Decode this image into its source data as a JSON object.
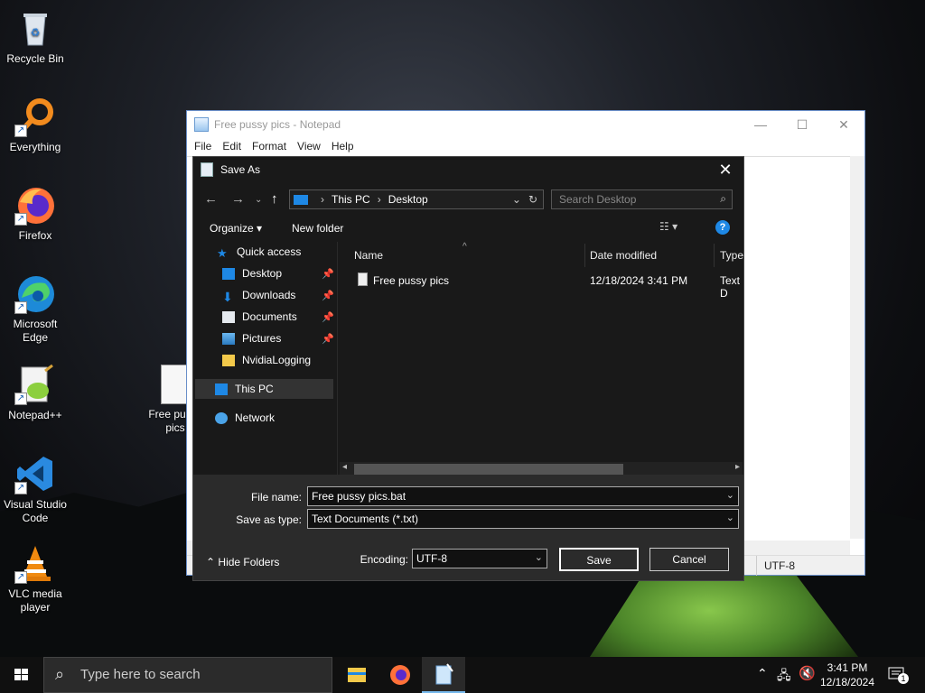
{
  "desktop": {
    "icons": [
      {
        "label": "Recycle Bin"
      },
      {
        "label": "Everything"
      },
      {
        "label": "Firefox"
      },
      {
        "label": "Microsoft Edge"
      },
      {
        "label": "Notepad++"
      },
      {
        "label": "Visual Studio Code"
      },
      {
        "label": "VLC media player"
      }
    ],
    "file_icon_label": "Free pussy pics"
  },
  "notepad": {
    "title": "Free pussy pics - Notepad",
    "menu": [
      "File",
      "Edit",
      "Format",
      "View",
      "Help"
    ],
    "status_encoding": "UTF-8"
  },
  "dialog": {
    "title": "Save As",
    "address": {
      "root": "This PC",
      "folder": "Desktop"
    },
    "search_placeholder": "Search Desktop",
    "toolbar": {
      "organize": "Organize",
      "new_folder": "New folder"
    },
    "nav": [
      {
        "label": "Quick access"
      },
      {
        "label": "Desktop",
        "pinned": true
      },
      {
        "label": "Downloads",
        "pinned": true
      },
      {
        "label": "Documents",
        "pinned": true
      },
      {
        "label": "Pictures",
        "pinned": true
      },
      {
        "label": "NvidiaLogging"
      },
      {
        "label": "This PC"
      },
      {
        "label": "Network"
      }
    ],
    "columns": {
      "name": "Name",
      "date": "Date modified",
      "type": "Type"
    },
    "files": [
      {
        "name": "Free pussy pics",
        "date": "12/18/2024 3:41 PM",
        "type": "Text D"
      }
    ],
    "file_name_label": "File name:",
    "file_name_value": "Free pussy pics.bat",
    "save_type_label": "Save as type:",
    "save_type_value": "Text Documents (*.txt)",
    "hide_folders": "Hide Folders",
    "encoding_label": "Encoding:",
    "encoding_value": "UTF-8",
    "save": "Save",
    "cancel": "Cancel"
  },
  "taskbar": {
    "search_placeholder": "Type here to search",
    "time": "3:41 PM",
    "date": "12/18/2024",
    "notification_count": "1"
  },
  "colors": {
    "accent": "#1e88e5",
    "dialog_bg": "#191919",
    "selected_nav": "#333333"
  }
}
